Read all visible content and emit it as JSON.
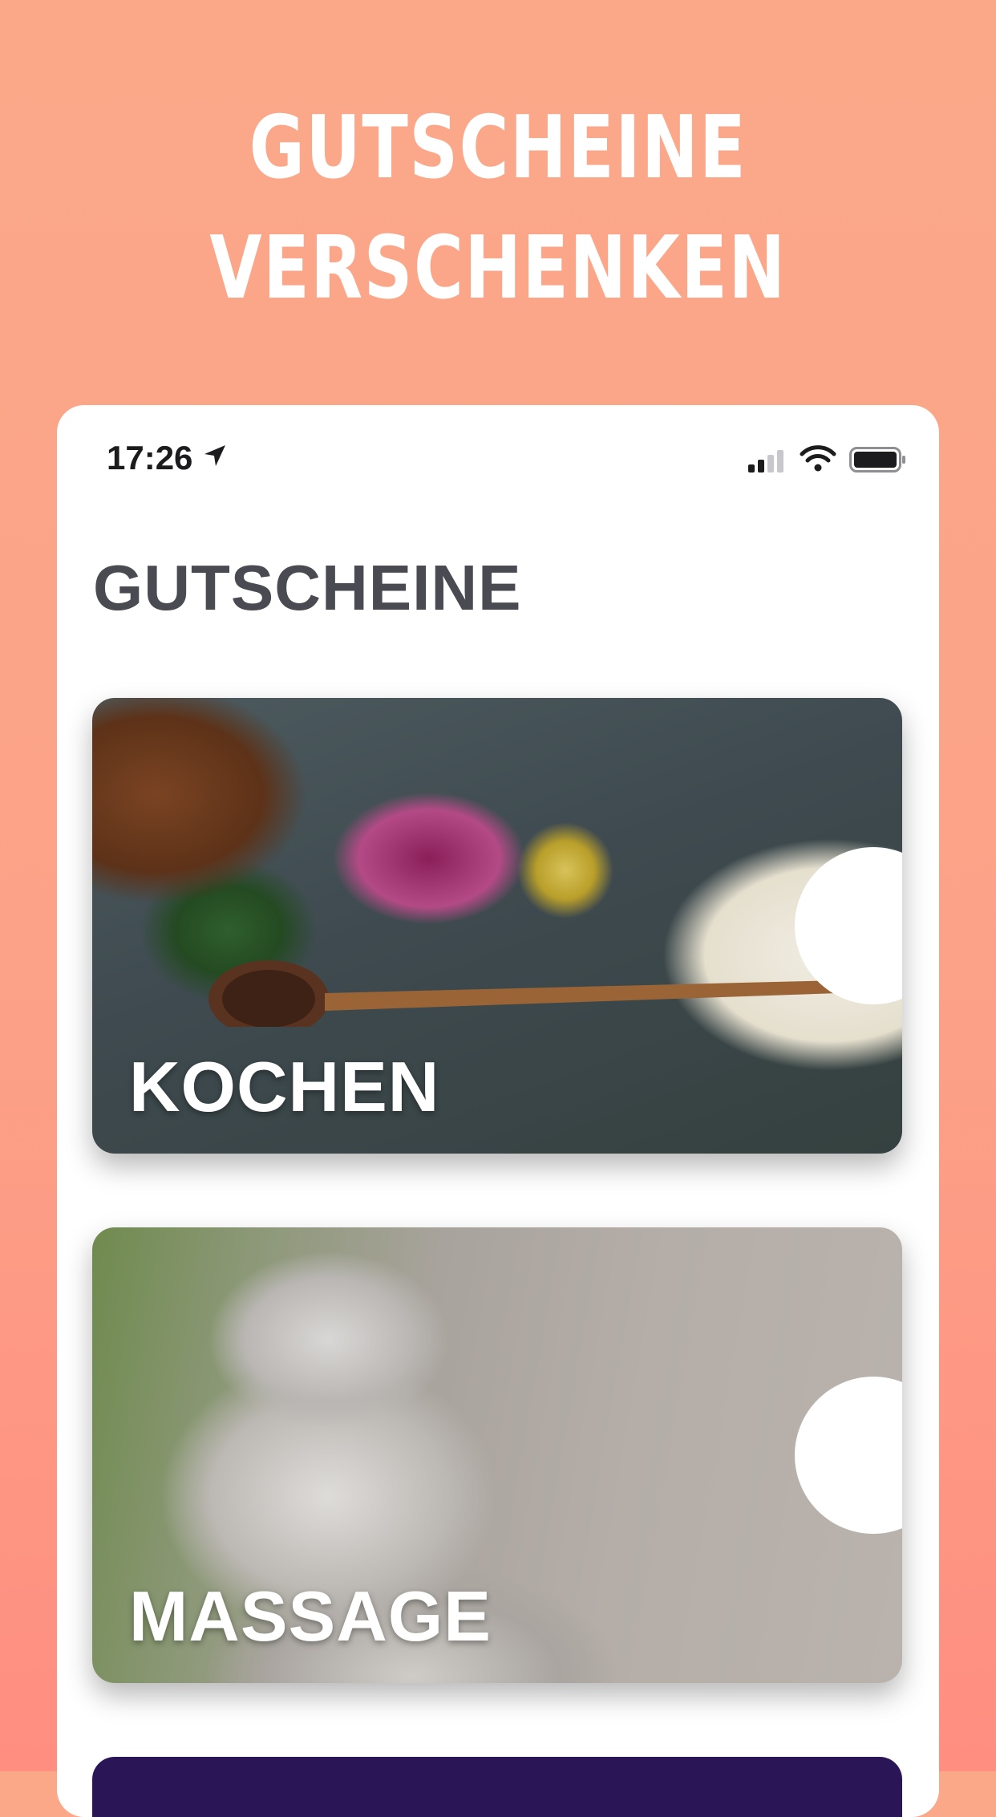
{
  "hero": {
    "line1": "GUTSCHEINE",
    "line2": "VERSCHENKEN"
  },
  "status_bar": {
    "time": "17:26",
    "icons": [
      "location-arrow-icon",
      "cellular-signal-icon",
      "wifi-icon",
      "battery-icon"
    ]
  },
  "page": {
    "title": "GUTSCHEINE"
  },
  "cards": [
    {
      "label": "KOCHEN",
      "image": "cooking-ingredients-photo"
    },
    {
      "label": "MASSAGE",
      "image": "spa-stones-photo"
    },
    {
      "label": "",
      "image": "purple-card-partial"
    }
  ],
  "colors": {
    "background_top": "#fba889",
    "background_bottom": "#ff8e80",
    "title_text": "#4a4a52",
    "card_label": "#ffffff"
  }
}
